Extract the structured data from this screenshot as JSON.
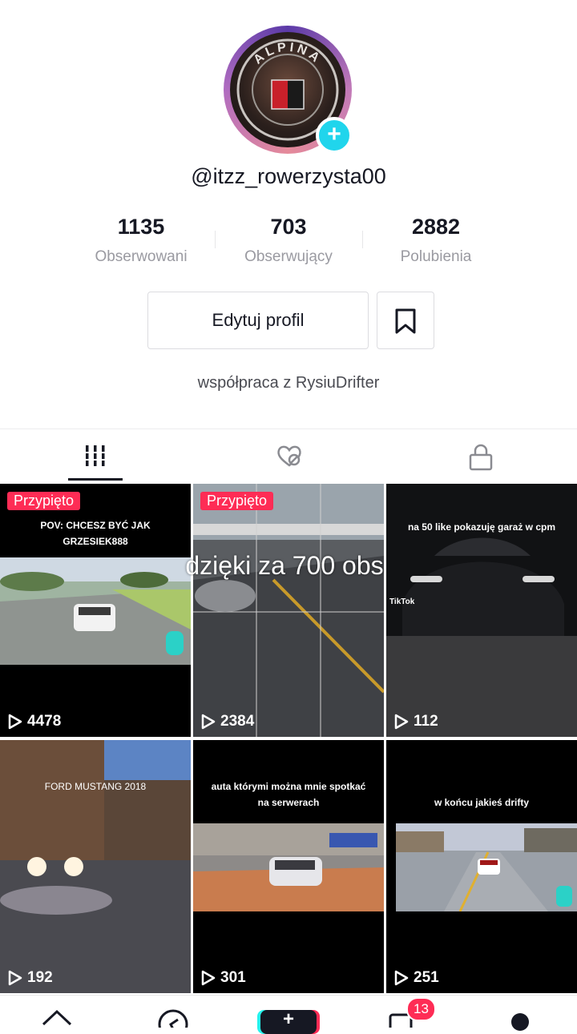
{
  "profile": {
    "username": "@itzz_rowerzysta00",
    "avatar_text": "ALPINA",
    "bio": "współpraca z RysiuDrifter",
    "add_icon": "plus-icon"
  },
  "stats": [
    {
      "value": "1135",
      "label": "Obserwowani"
    },
    {
      "value": "703",
      "label": "Obserwujący"
    },
    {
      "value": "2882",
      "label": "Polubienia"
    }
  ],
  "actions": {
    "edit_label": "Edytuj profil",
    "bookmark_icon": "bookmark-icon"
  },
  "tabs": [
    {
      "icon": "grid-icon",
      "active": true
    },
    {
      "icon": "liked-hidden-icon",
      "active": false
    },
    {
      "icon": "lock-icon",
      "active": false
    }
  ],
  "overlay_text": "dzięki za 700 obs",
  "videos": [
    {
      "pinned": "Przypięto",
      "caption": "POV: CHCESZ BYĆ JAK GRZESIEK888",
      "views": "4478"
    },
    {
      "pinned": "Przypięto",
      "caption": "",
      "views": "2384"
    },
    {
      "pinned": "",
      "caption": "na 50 like pokazuję garaż w cpm",
      "views": "112",
      "watermark": "TikTok"
    },
    {
      "pinned": "",
      "caption": "FORD MUSTANG 2018",
      "views": "192"
    },
    {
      "pinned": "",
      "caption": "auta którymi można mnie spotkać na serwerach",
      "views": "301"
    },
    {
      "pinned": "",
      "caption": "w końcu jakieś drifty",
      "views": "251"
    }
  ],
  "navbar": {
    "items": [
      "home-icon",
      "discover-icon",
      "create-button",
      "inbox-icon",
      "profile-icon"
    ],
    "create_label": "+",
    "inbox_badge": "13"
  },
  "colors": {
    "accent": "#fe2c55",
    "cyan": "#20d5ec",
    "text": "#161823",
    "muted": "#9a9aa1"
  }
}
